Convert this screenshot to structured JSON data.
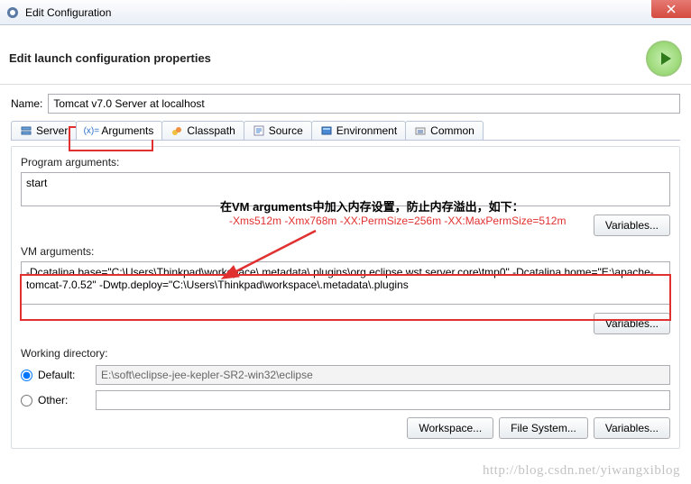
{
  "window": {
    "title": "Edit Configuration"
  },
  "header": {
    "title": "Edit launch configuration properties"
  },
  "name": {
    "label": "Name:",
    "value": "Tomcat v7.0 Server at localhost"
  },
  "tabs": {
    "server": "Server",
    "arguments": "Arguments",
    "classpath": "Classpath",
    "source": "Source",
    "environment": "Environment",
    "common": "Common"
  },
  "program_args": {
    "label": "Program arguments:",
    "value": "start",
    "variables_btn": "Variables..."
  },
  "annotation": {
    "line1": "在VM arguments中加入内存设置，防止内存溢出，如下：",
    "line2": "-Xms512m -Xmx768m -XX:PermSize=256m -XX:MaxPermSize=512m"
  },
  "vm_args": {
    "label": "VM arguments:",
    "value": "-Dcatalina.base=\"C:\\Users\\Thinkpad\\workspace\\.metadata\\.plugins\\org.eclipse.wst.server.core\\tmp0\" -Dcatalina.home=\"E:\\apache-tomcat-7.0.52\" -Dwtp.deploy=\"C:\\Users\\Thinkpad\\workspace\\.metadata\\.plugins",
    "variables_btn": "Variables..."
  },
  "workdir": {
    "label": "Working directory:",
    "default_label": "Default:",
    "default_value": "E:\\soft\\eclipse-jee-kepler-SR2-win32\\eclipse",
    "other_label": "Other:",
    "other_value": "",
    "workspace_btn": "Workspace...",
    "filesystem_btn": "File System...",
    "variables_btn": "Variables..."
  },
  "watermark": "http://blog.csdn.net/yiwangxiblog"
}
